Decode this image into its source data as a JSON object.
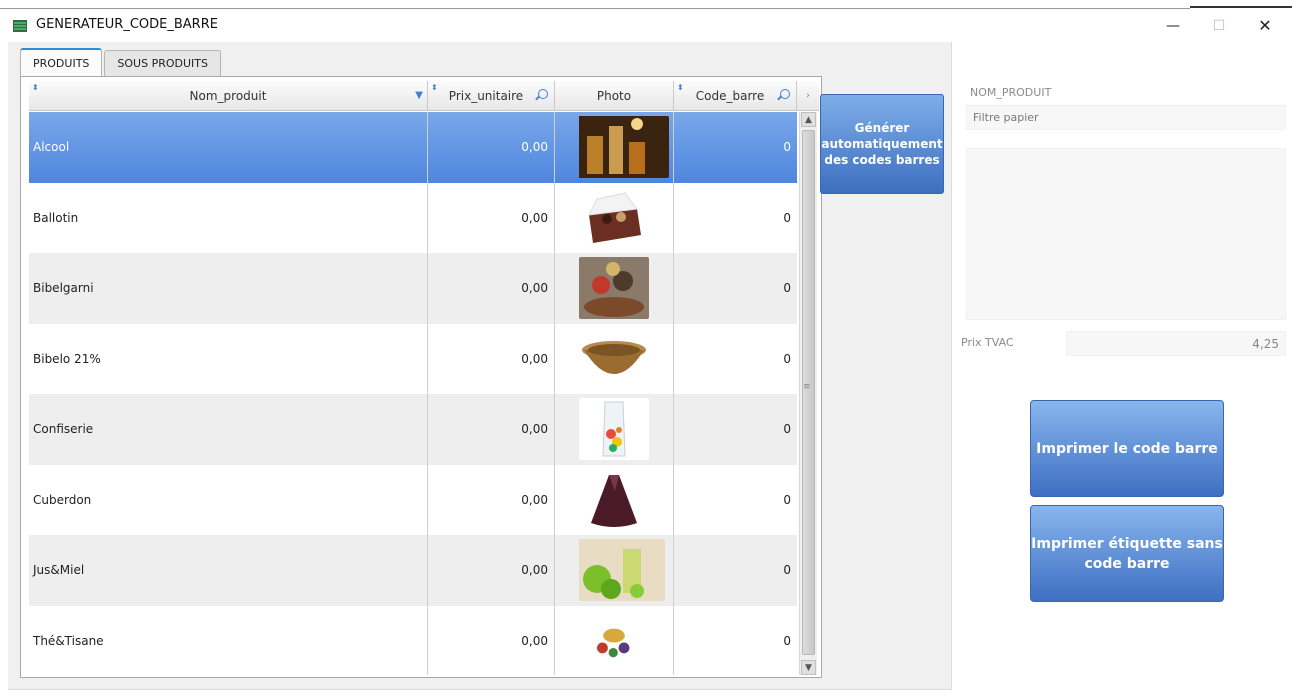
{
  "window": {
    "title": "GENERATEUR_CODE_BARRE",
    "minimize": "—",
    "maximize": "☐",
    "close": "✕"
  },
  "tabs": [
    {
      "label": "PRODUITS",
      "active": true
    },
    {
      "label": "SOUS PRODUITS",
      "active": false
    }
  ],
  "grid": {
    "columns": [
      "Nom_produit",
      "Prix_unitaire",
      "Photo",
      "Code_barre"
    ],
    "rows": [
      {
        "nom": "Alcool",
        "prix": "0,00",
        "code": "0",
        "photo": "drinks-photo",
        "selected": true
      },
      {
        "nom": "Ballotin",
        "prix": "0,00",
        "code": "0",
        "photo": "chocolate-box-photo",
        "selected": false
      },
      {
        "nom": "Bibelgarni",
        "prix": "0,00",
        "code": "0",
        "photo": "gift-basket-photo",
        "selected": false
      },
      {
        "nom": "Bibelo 21%",
        "prix": "0,00",
        "code": "0",
        "photo": "wicker-basket-photo",
        "selected": false
      },
      {
        "nom": "Confiserie",
        "prix": "0,00",
        "code": "0",
        "photo": "candy-bag-photo",
        "selected": false
      },
      {
        "nom": "Cuberdon",
        "prix": "0,00",
        "code": "0",
        "photo": "cuberdon-photo",
        "selected": false
      },
      {
        "nom": "Jus&Miel",
        "prix": "0,00",
        "code": "0",
        "photo": "juice-apples-photo",
        "selected": false
      },
      {
        "nom": "Thé&Tisane",
        "prix": "0,00",
        "code": "0",
        "photo": "tea-photo",
        "selected": false
      }
    ]
  },
  "generate_button": "Générer automatiquement des codes barres",
  "right_panel": {
    "nom_label": "NOM_PRODUIT",
    "nom_value": "Filtre papier",
    "prix_label": "Prix TVAC",
    "prix_value": "4,25"
  },
  "print_button": "Imprimer le code barre",
  "print_label_button": "Imprimer étiquette sans code barre",
  "colors": {
    "accent": "#2e8fd7",
    "button_top": "#88b6ee",
    "button_bottom": "#3e6fc2",
    "selection": "#5b8fe0"
  }
}
